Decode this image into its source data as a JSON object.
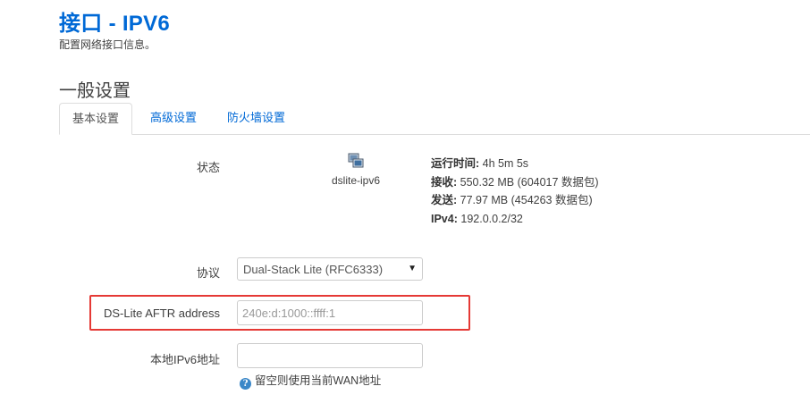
{
  "page": {
    "title": "接口 - IPV6",
    "description": "配置网络接口信息。"
  },
  "section": {
    "title": "一般设置"
  },
  "tabs": [
    {
      "label": "基本设置",
      "active": true
    },
    {
      "label": "高级设置",
      "active": false
    },
    {
      "label": "防火墙设置",
      "active": false
    }
  ],
  "status": {
    "label": "状态",
    "interface_icon": "network-interface-icon",
    "interface_name": "dslite-ipv6",
    "uptime_label": "运行时间:",
    "uptime_value": " 4h 5m 5s",
    "rx_label": "接收:",
    "rx_value": " 550.32 MB (604017 数据包)",
    "tx_label": "发送:",
    "tx_value": " 77.97 MB (454263 数据包)",
    "ipv4_label": "IPv4:",
    "ipv4_value": " 192.0.0.2/32"
  },
  "protocol": {
    "label": "协议",
    "selected": "Dual-Stack Lite (RFC6333)"
  },
  "aftr": {
    "label": "DS-Lite AFTR address",
    "placeholder": "240e:d:1000::ffff:1",
    "value": ""
  },
  "local_ipv6": {
    "label": "本地IPv6地址",
    "value": "",
    "hint_icon": "info-icon",
    "hint": "留空则使用当前WAN地址"
  },
  "colors": {
    "accent": "#0069d6",
    "highlight": "#e53935",
    "hint_icon": "#3a87c8"
  }
}
